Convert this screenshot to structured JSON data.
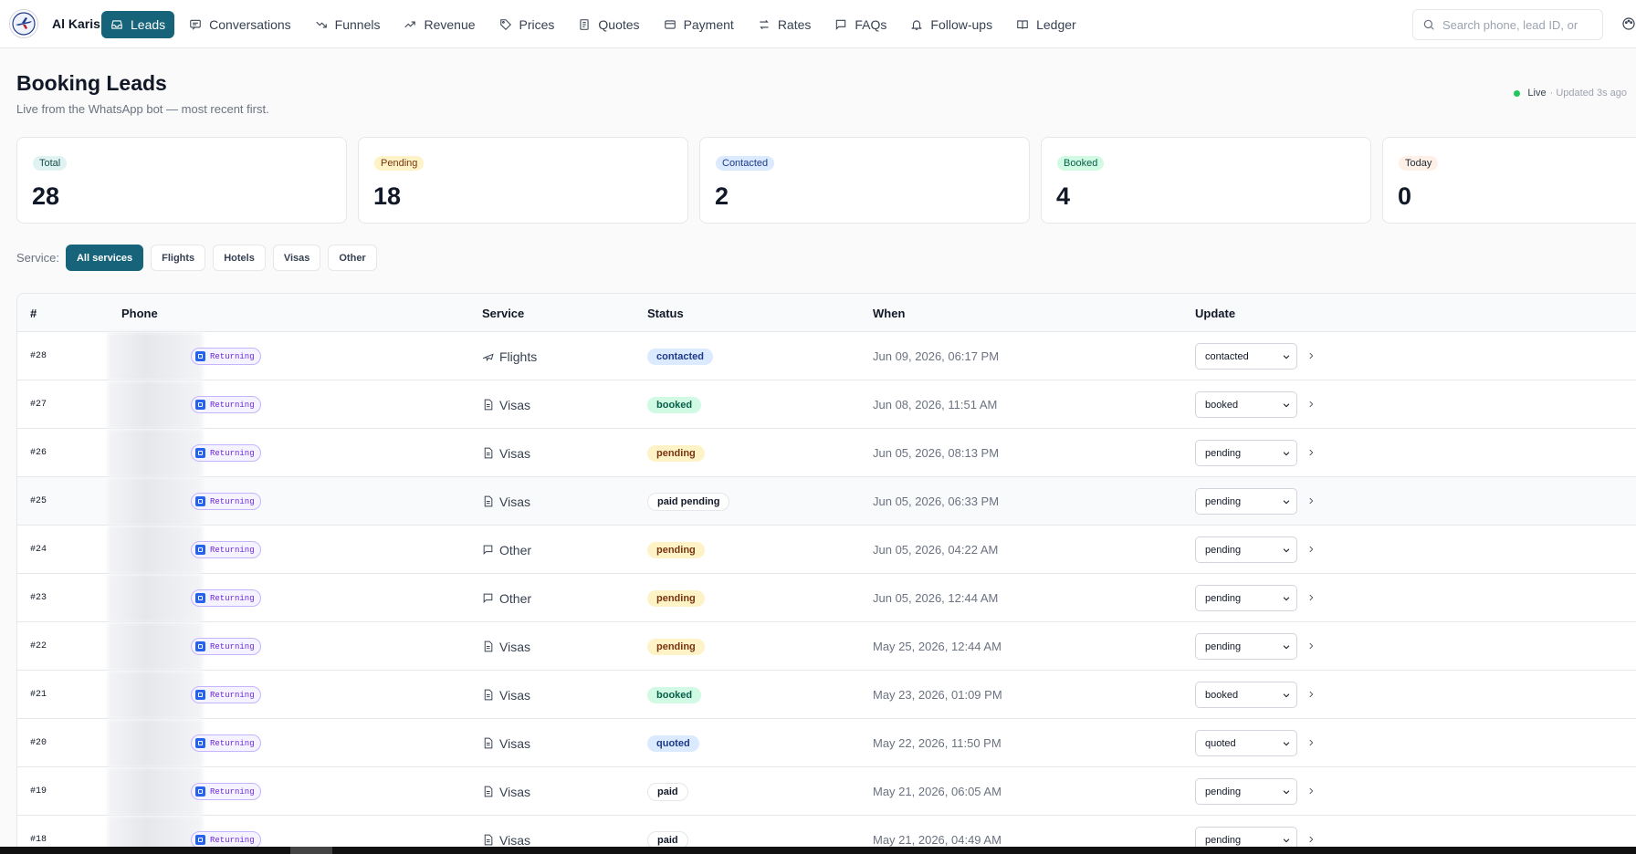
{
  "brand": {
    "name": "Al Karis"
  },
  "nav": [
    {
      "label": "Leads",
      "icon": "inbox-icon",
      "active": true
    },
    {
      "label": "Conversations",
      "icon": "message-icon"
    },
    {
      "label": "Funnels",
      "icon": "funnel-trend-icon"
    },
    {
      "label": "Revenue",
      "icon": "trending-up-icon"
    },
    {
      "label": "Prices",
      "icon": "tag-icon"
    },
    {
      "label": "Quotes",
      "icon": "receipt-icon"
    },
    {
      "label": "Payment",
      "icon": "credit-card-icon"
    },
    {
      "label": "Rates",
      "icon": "arrows-swap-icon"
    },
    {
      "label": "FAQs",
      "icon": "chat-bubble-icon"
    },
    {
      "label": "Follow-ups",
      "icon": "bell-icon"
    },
    {
      "label": "Ledger",
      "icon": "book-icon"
    }
  ],
  "search": {
    "placeholder": "Search phone, lead ID, or"
  },
  "page": {
    "title": "Booking Leads",
    "subtitle": "Live from the WhatsApp bot — most recent first.",
    "live_label": "Live",
    "updated": "· Updated 3s ago"
  },
  "stats": [
    {
      "label": "Total",
      "value": "28",
      "bg": "#e0f2f1",
      "color": "#134e4a"
    },
    {
      "label": "Pending",
      "value": "18",
      "bg": "#fef3c7",
      "color": "#78350f"
    },
    {
      "label": "Contacted",
      "value": "2",
      "bg": "#dbeafe",
      "color": "#1e3a8a"
    },
    {
      "label": "Booked",
      "value": "4",
      "bg": "#d1fae5",
      "color": "#065f46"
    },
    {
      "label": "Today",
      "value": "0",
      "bg": "#fef0e6",
      "color": "#1f2937"
    }
  ],
  "filters": {
    "label": "Service:",
    "options": [
      "All services",
      "Flights",
      "Hotels",
      "Visas",
      "Other"
    ],
    "active": "All services"
  },
  "table": {
    "columns": [
      "#",
      "Phone",
      "Service",
      "Status",
      "When",
      "Update"
    ],
    "returning_label": "Returning",
    "rows": [
      {
        "id": "#28",
        "service": "Flights",
        "service_icon": "plane-icon",
        "status": "contacted",
        "when": "Jun 09, 2026, 06:17 PM",
        "update": "contacted"
      },
      {
        "id": "#27",
        "service": "Visas",
        "service_icon": "document-icon",
        "status": "booked",
        "when": "Jun 08, 2026, 11:51 AM",
        "update": "booked"
      },
      {
        "id": "#26",
        "service": "Visas",
        "service_icon": "document-icon",
        "status": "pending",
        "when": "Jun 05, 2026, 08:13 PM",
        "update": "pending"
      },
      {
        "id": "#25",
        "service": "Visas",
        "service_icon": "document-icon",
        "status": "paid pending",
        "when": "Jun 05, 2026, 06:33 PM",
        "update": "pending",
        "highlight": true
      },
      {
        "id": "#24",
        "service": "Other",
        "service_icon": "chat-bubble-icon",
        "status": "pending",
        "when": "Jun 05, 2026, 04:22 AM",
        "update": "pending"
      },
      {
        "id": "#23",
        "service": "Other",
        "service_icon": "chat-bubble-icon",
        "status": "pending",
        "when": "Jun 05, 2026, 12:44 AM",
        "update": "pending"
      },
      {
        "id": "#22",
        "service": "Visas",
        "service_icon": "document-icon",
        "status": "pending",
        "when": "May 25, 2026, 12:44 AM",
        "update": "pending"
      },
      {
        "id": "#21",
        "service": "Visas",
        "service_icon": "document-icon",
        "status": "booked",
        "when": "May 23, 2026, 01:09 PM",
        "update": "booked"
      },
      {
        "id": "#20",
        "service": "Visas",
        "service_icon": "document-icon",
        "status": "quoted",
        "when": "May 22, 2026, 11:50 PM",
        "update": "quoted"
      },
      {
        "id": "#19",
        "service": "Visas",
        "service_icon": "document-icon",
        "status": "paid",
        "when": "May 21, 2026, 06:05 AM",
        "update": "pending"
      },
      {
        "id": "#18",
        "service": "Visas",
        "service_icon": "document-icon",
        "status": "paid",
        "when": "May 21, 2026, 04:49 AM",
        "update": "pending"
      }
    ]
  }
}
